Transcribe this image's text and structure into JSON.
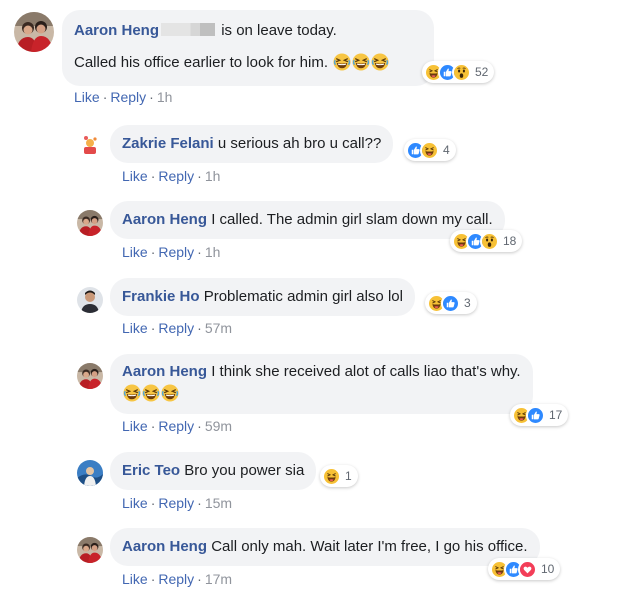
{
  "thread": {
    "comments": [
      {
        "author": "Aaron Heng",
        "line1": "is on leave today.",
        "line2": "Called his office earlier to look for him.",
        "reaction_count": "52",
        "like": "Like",
        "reply": "Reply",
        "time": "1h"
      },
      {
        "author": "Zakrie Felani",
        "text": "u serious ah bro u call??",
        "reaction_count": "4",
        "like": "Like",
        "reply": "Reply",
        "time": "1h"
      },
      {
        "author": "Aaron Heng",
        "text": "I called. The admin girl slam down my call.",
        "reaction_count": "18",
        "like": "Like",
        "reply": "Reply",
        "time": "1h"
      },
      {
        "author": "Frankie Ho",
        "text": "Problematic admin girl also lol",
        "reaction_count": "3",
        "like": "Like",
        "reply": "Reply",
        "time": "57m"
      },
      {
        "author": "Aaron Heng",
        "text": "I think she received alot of calls liao that's why.",
        "reaction_count": "17",
        "like": "Like",
        "reply": "Reply",
        "time": "59m"
      },
      {
        "author": "Eric Teo",
        "text": "Bro you power sia",
        "reaction_count": "1",
        "like": "Like",
        "reply": "Reply",
        "time": "15m"
      },
      {
        "author": "Aaron Heng",
        "text": "Call only mah. Wait later I'm free, I go his office.",
        "reaction_count": "10",
        "like": "Like",
        "reply": "Reply",
        "time": "17m"
      }
    ],
    "separator": "·"
  },
  "colors": {
    "author_link": "#385898",
    "action_link": "#4267b2",
    "bubble_bg": "#f2f3f5",
    "like_blue": "#1877f2",
    "haha_yellow": "#f7b125",
    "angry_red": "#e9710f"
  },
  "icons": [
    "laughing-emoji",
    "like-reaction-icon",
    "haha-reaction-icon",
    "wow-reaction-icon",
    "love-reaction-icon"
  ]
}
